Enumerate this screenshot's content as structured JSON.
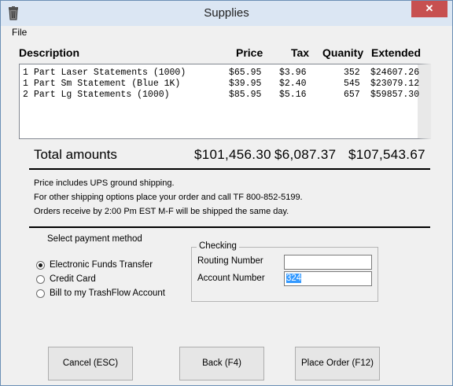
{
  "window": {
    "title": "Supplies",
    "close_glyph": "✕",
    "app_icon": "trash-can-icon"
  },
  "menu": {
    "file": "File"
  },
  "columns": {
    "description": "Description",
    "price": "Price",
    "tax": "Tax",
    "quantity": "Quanity",
    "extended": "Extended"
  },
  "items": [
    {
      "qty": "1",
      "description": "Part Laser Statements (1000)",
      "price": "$65.95",
      "tax": "$3.96",
      "quantity": "352",
      "extended": "$24607.26"
    },
    {
      "qty": "1",
      "description": "Part Sm Statement (Blue 1K)",
      "price": "$39.95",
      "tax": "$2.40",
      "quantity": "545",
      "extended": "$23079.12"
    },
    {
      "qty": "2",
      "description": "Part Lg Statements (1000)",
      "price": "$85.95",
      "tax": "$5.16",
      "quantity": "657",
      "extended": "$59857.30"
    }
  ],
  "totals": {
    "label": "Total amounts",
    "price": "$101,456.30",
    "tax": "$6,087.37",
    "extended": "$107,543.67"
  },
  "shipping_info": {
    "line1": "Price includes UPS ground shipping.",
    "line2": "For other shipping options place your order and call TF 800-852-5199.",
    "line3": "Orders receive by 2:00 Pm EST M-F will be shipped the same day."
  },
  "payment": {
    "title": "Select payment method",
    "options": [
      {
        "label": "Electronic Funds Transfer",
        "selected": true
      },
      {
        "label": "Credit Card",
        "selected": false
      },
      {
        "label": "Bill to my TrashFlow Account",
        "selected": false
      }
    ]
  },
  "checking": {
    "legend": "Checking",
    "routing_label": "Routing Number",
    "routing_value": "",
    "account_label": "Account Number",
    "account_value": "324"
  },
  "buttons": {
    "cancel": "Cancel (ESC)",
    "back": "Back (F4)",
    "place_order": "Place Order (F12)"
  }
}
